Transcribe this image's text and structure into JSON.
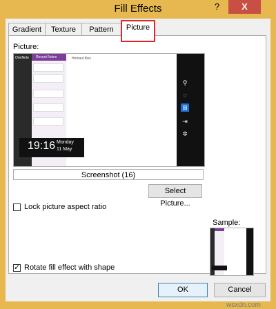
{
  "window": {
    "title": "Fill Effects",
    "help": "?",
    "close": "X"
  },
  "tabs": [
    {
      "label": "Gradient",
      "active": false
    },
    {
      "label": "Texture",
      "active": false
    },
    {
      "label": "Pattern",
      "active": false
    },
    {
      "label": "Picture",
      "active": true
    }
  ],
  "picture": {
    "label": "Picture:",
    "filename": "Screenshot (16)",
    "select_button": "Select Picture...",
    "lock_aspect": {
      "label": "Lock picture aspect ratio",
      "checked": false
    },
    "rotate_fill": {
      "label": "Rotate fill effect with shape",
      "checked": true
    },
    "sample_label": "Sample:"
  },
  "preview_screenshot": {
    "app_name": "OneNote",
    "list_header": "Recent Notes",
    "main_header": "Hemant files",
    "time": "19:16",
    "day": "Monday",
    "date": "11 May"
  },
  "buttons": {
    "ok": "OK",
    "cancel": "Cancel"
  },
  "watermark": "wsxdn.com",
  "colors": {
    "title_bar": "#e6b84f",
    "close_button": "#c74f43",
    "highlight": "#e2242b",
    "onenote_purple": "#7b3f99"
  }
}
